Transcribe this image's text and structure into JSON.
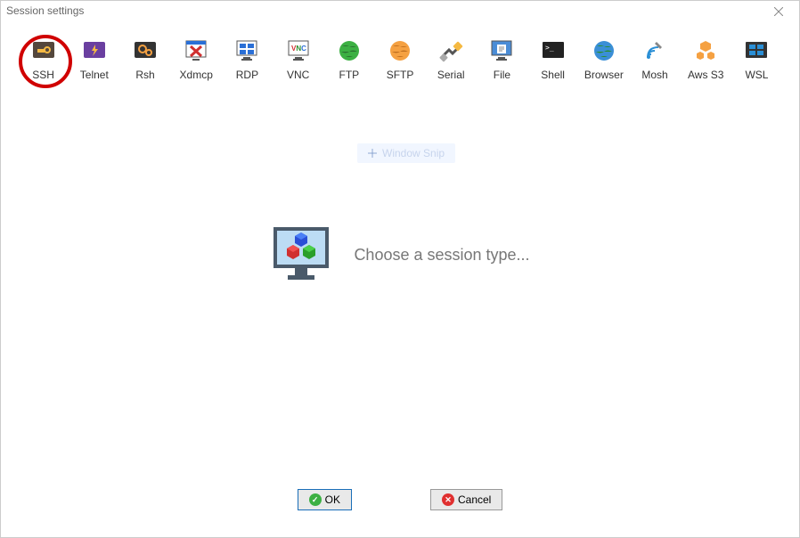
{
  "window": {
    "title": "Session settings"
  },
  "toolbar": {
    "items": [
      {
        "label": "SSH",
        "icon": "key-icon"
      },
      {
        "label": "Telnet",
        "icon": "bolt-icon"
      },
      {
        "label": "Rsh",
        "icon": "gears-icon"
      },
      {
        "label": "Xdmcp",
        "icon": "xwindow-icon"
      },
      {
        "label": "RDP",
        "icon": "rdp-icon"
      },
      {
        "label": "VNC",
        "icon": "vnc-icon"
      },
      {
        "label": "FTP",
        "icon": "globe-green-icon"
      },
      {
        "label": "SFTP",
        "icon": "globe-orange-icon"
      },
      {
        "label": "Serial",
        "icon": "serial-icon"
      },
      {
        "label": "File",
        "icon": "file-monitor-icon"
      },
      {
        "label": "Shell",
        "icon": "terminal-icon"
      },
      {
        "label": "Browser",
        "icon": "globe-blue-icon"
      },
      {
        "label": "Mosh",
        "icon": "satellite-icon"
      },
      {
        "label": "Aws S3",
        "icon": "aws-icon"
      },
      {
        "label": "WSL",
        "icon": "windows-icon"
      }
    ]
  },
  "highlighted_item_index": 0,
  "watermark": {
    "text": "Window Snip"
  },
  "main": {
    "prompt": "Choose a session type..."
  },
  "buttons": {
    "ok": "OK",
    "cancel": "Cancel"
  }
}
